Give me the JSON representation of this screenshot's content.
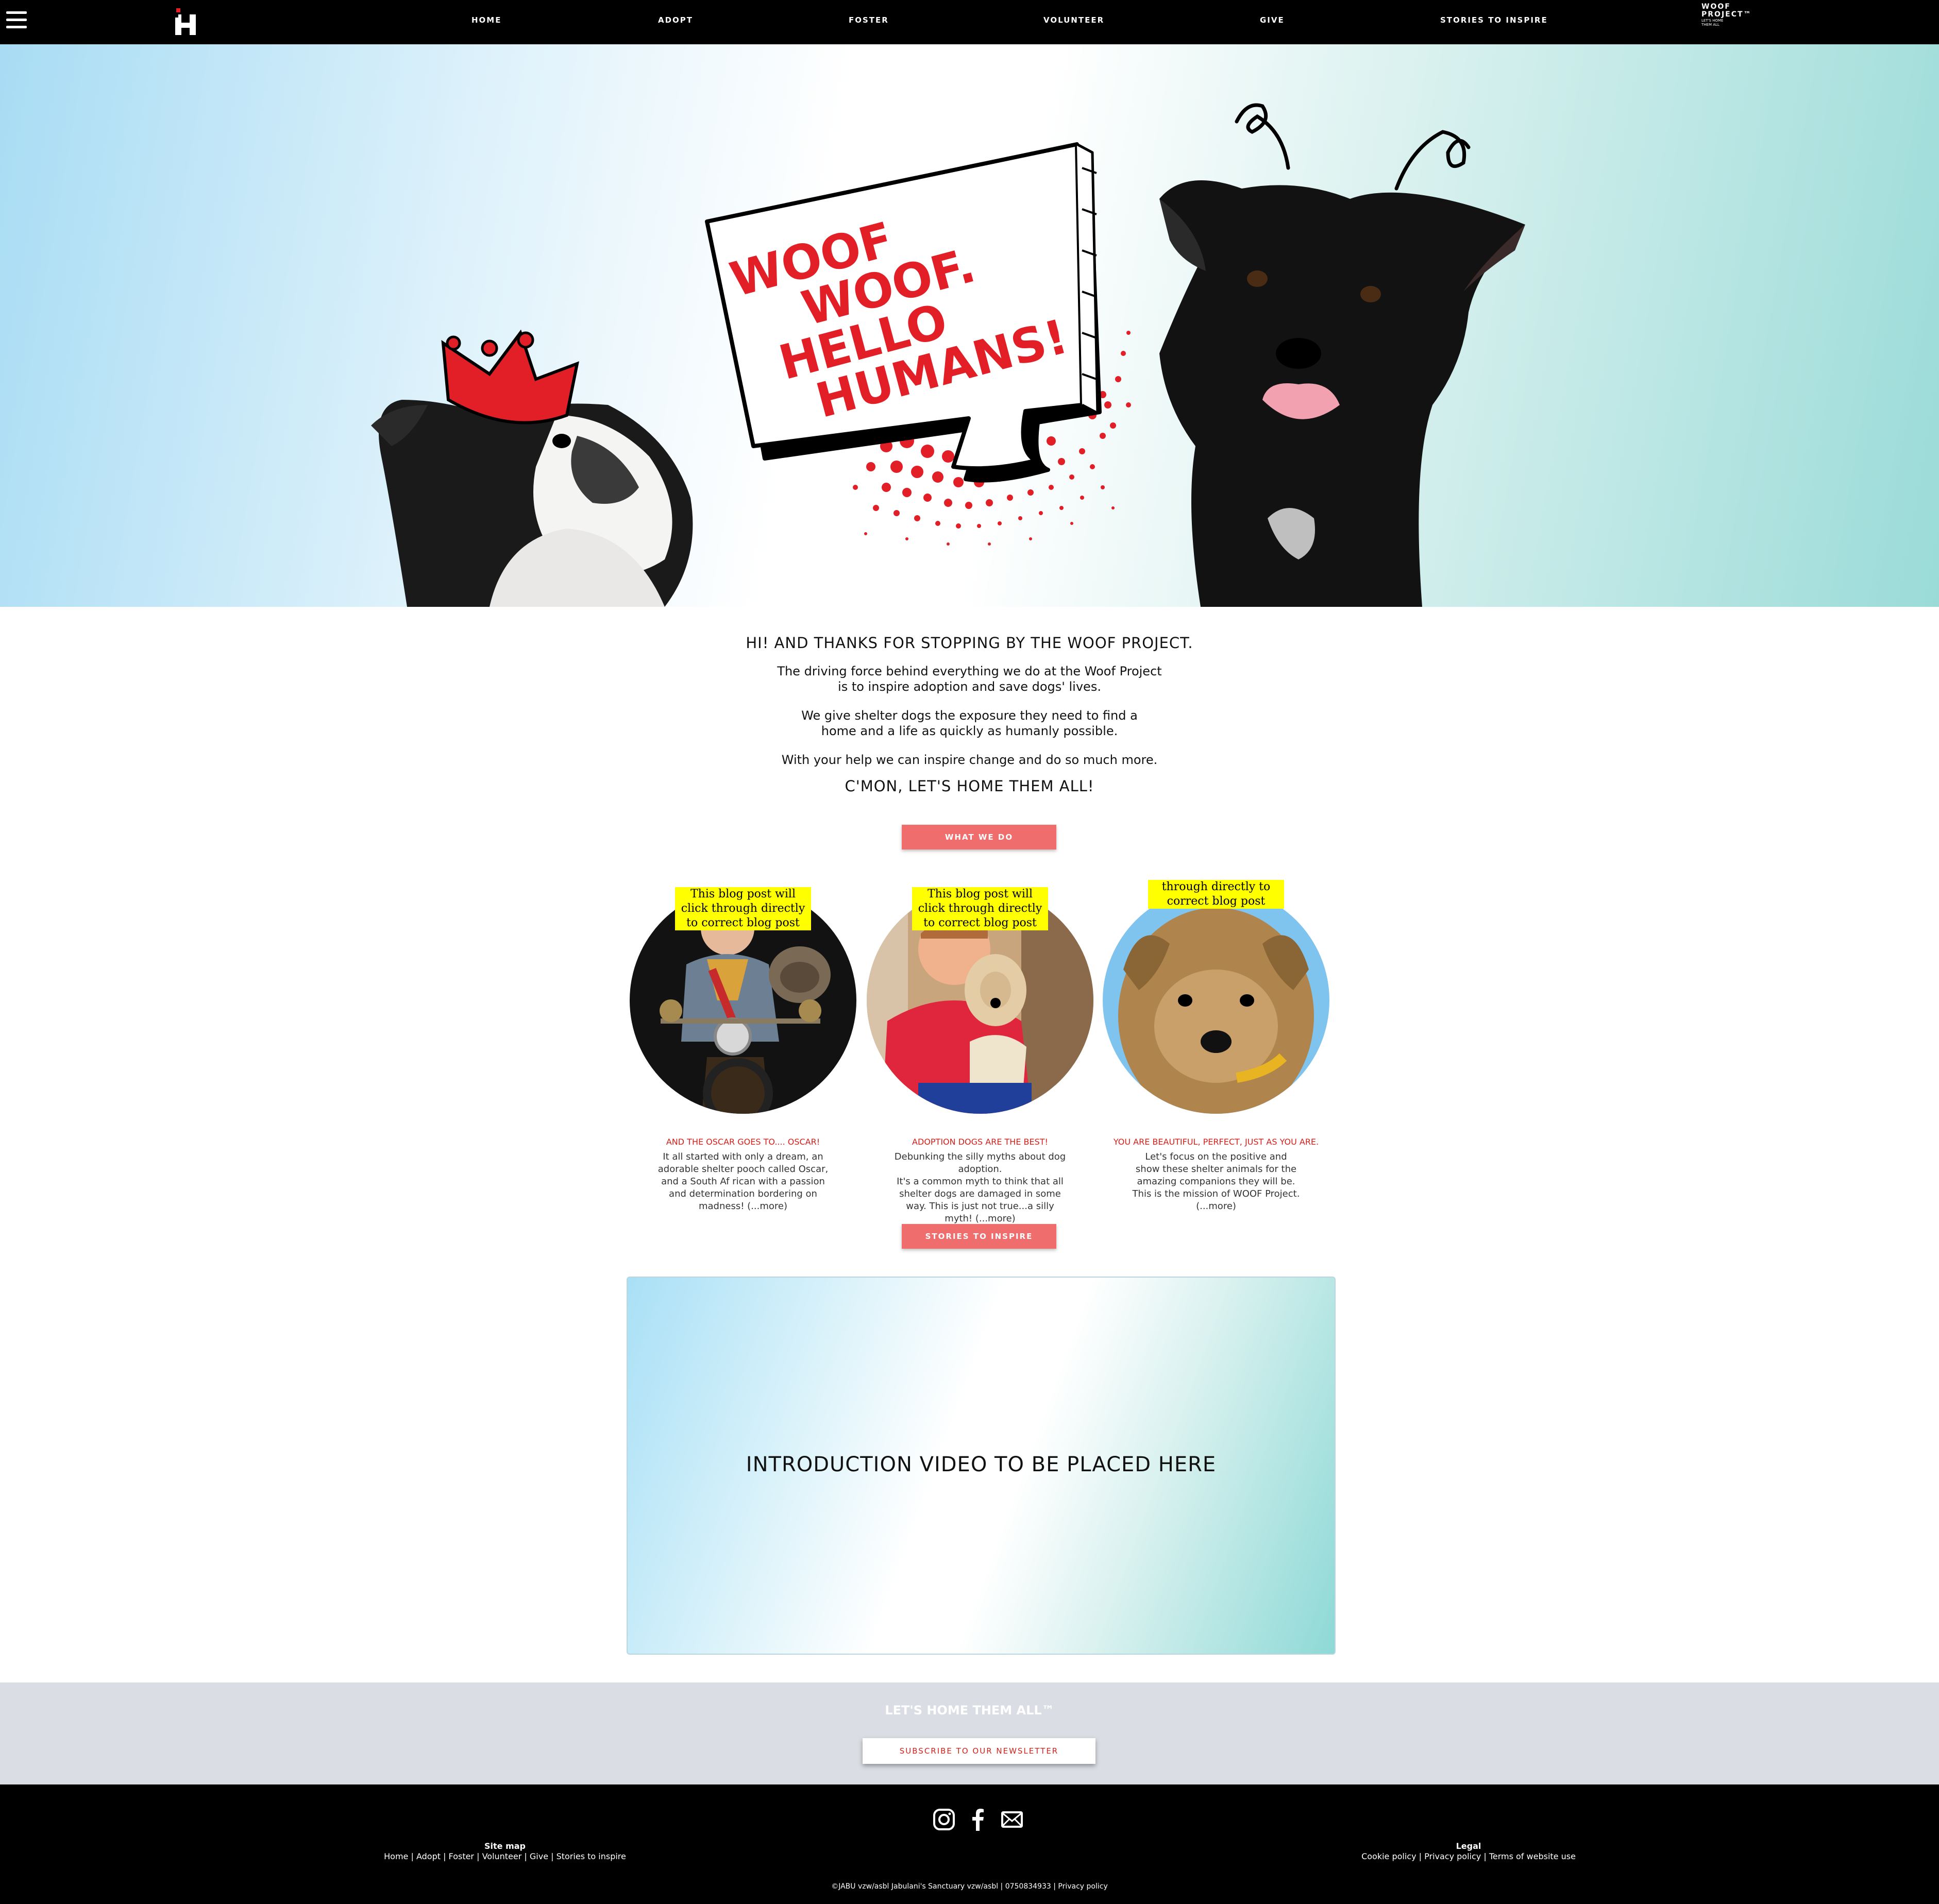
{
  "nav": {
    "items": [
      "HOME",
      "ADOPT",
      "FOSTER",
      "VOLUNTEER",
      "GIVE",
      "STORIES TO INSPIRE"
    ],
    "brand_line1": "WOOF",
    "brand_line2": "PROJECT™",
    "brand_tagline": "LET'S HOME THEM ALL"
  },
  "hero": {
    "bubble_lines": [
      "WOOF",
      "WOOF.",
      "HELLO",
      "HUMANS!"
    ],
    "accent_color": "#e21f26"
  },
  "intro": {
    "heading": "HI! AND THANKS FOR STOPPING BY THE WOOF PROJECT.",
    "p1_line1": "The driving force behind everything we do at the Woof Project",
    "p1_line2": "is to inspire adoption and save dogs' lives.",
    "p2_line1": "We give shelter dogs the exposure they need to find a",
    "p2_line2": "home and a life as quickly as humanly possible.",
    "p3": "With your help we can inspire change and do so much more.",
    "cta_heading": "C'MON, LET'S HOME THEM ALL!",
    "what_we_do_button": "WHAT WE DO"
  },
  "blog_posts": [
    {
      "note": "This blog post will click through directly to correct blog post",
      "title": "AND THE OSCAR GOES TO.... OSCAR!",
      "line1": "It all started with only a dream, an",
      "line2": "adorable shelter pooch called Oscar,",
      "line3": "and a South Af rican with a passion",
      "line4": "and determination bordering on",
      "line5": "madness! (...more)"
    },
    {
      "note": "This blog post will click through directly to correct blog post",
      "title": "ADOPTION DOGS ARE THE BEST!",
      "line1": "Debunking the silly myths about dog adoption.",
      "line2": "It's a common myth to think that all",
      "line3": "shelter dogs are damaged in some",
      "line4": "way. This is just not true...a silly",
      "line5": "myth! (...more)"
    },
    {
      "note": "through directly to correct blog post",
      "title": "YOU ARE BEAUTIFUL, PERFECT, JUST AS YOU ARE.",
      "line1": "Let's focus on the positive and",
      "line2": "show these shelter animals for the",
      "line3": "amazing companions they will be.",
      "line4": "This is the mission of WOOF Project.",
      "line5": "(...more)"
    }
  ],
  "stories_button": "STORIES TO INSPIRE",
  "video": {
    "label": "INTRODUCTION VIDEO TO BE PLACED HERE"
  },
  "newsletter": {
    "title": "LET'S HOME THEM ALL™",
    "button": "SUBSCRIBE TO OUR NEWSLETTER"
  },
  "footer": {
    "social_icons": [
      "instagram-icon",
      "facebook-icon",
      "mail-icon"
    ],
    "sitemap_title": "Site map",
    "sitemap_links": "Home | Adopt | Foster | Volunteer | Give | Stories to inspire",
    "legal_title": "Legal",
    "legal_links": "Cookie policy | Privacy policy | Terms of website use",
    "copyright": "©JABU vzw/asbl Jabulani's Sanctuary vzw/asbl | 0750834933 | Privacy policy"
  }
}
